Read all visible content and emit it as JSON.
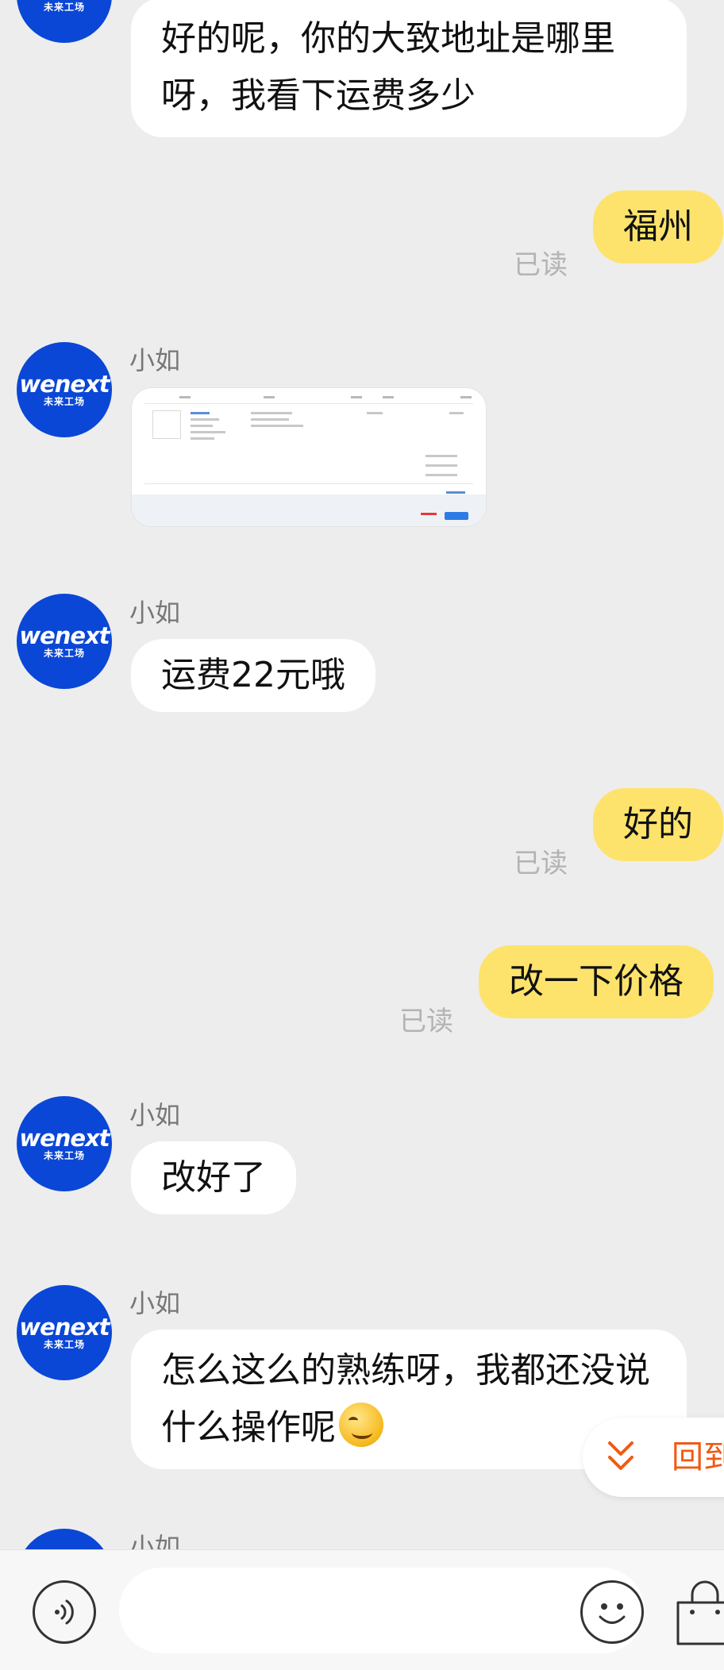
{
  "contact_name": "小如",
  "avatar": {
    "brand": "wenext",
    "subtitle": "未来工场"
  },
  "messages": [
    {
      "text": "好的呢，你的大致地址是哪里呀，我看下运费多少"
    },
    {
      "text": "福州",
      "status": "已读"
    },
    {
      "sender": "小如"
    },
    {
      "sender": "小如",
      "text": "运费22元哦"
    },
    {
      "text": "好的",
      "status": "已读"
    },
    {
      "text": "改一下价格",
      "status": "已读"
    },
    {
      "sender": "小如",
      "text": "改好了"
    },
    {
      "sender": "小如",
      "text": "怎么这么的熟练呀，我都还没说什么操作呢"
    },
    {
      "sender": "小如"
    }
  ],
  "jump_button": {
    "label": "回到"
  },
  "colors": {
    "own_bubble": "#fde36c",
    "avatar_bg": "#0a47d6",
    "accent": "#f05a14"
  },
  "icons": [
    "voice-icon",
    "emoji-icon",
    "shopping-bag-icon",
    "double-chevron-down-icon"
  ]
}
